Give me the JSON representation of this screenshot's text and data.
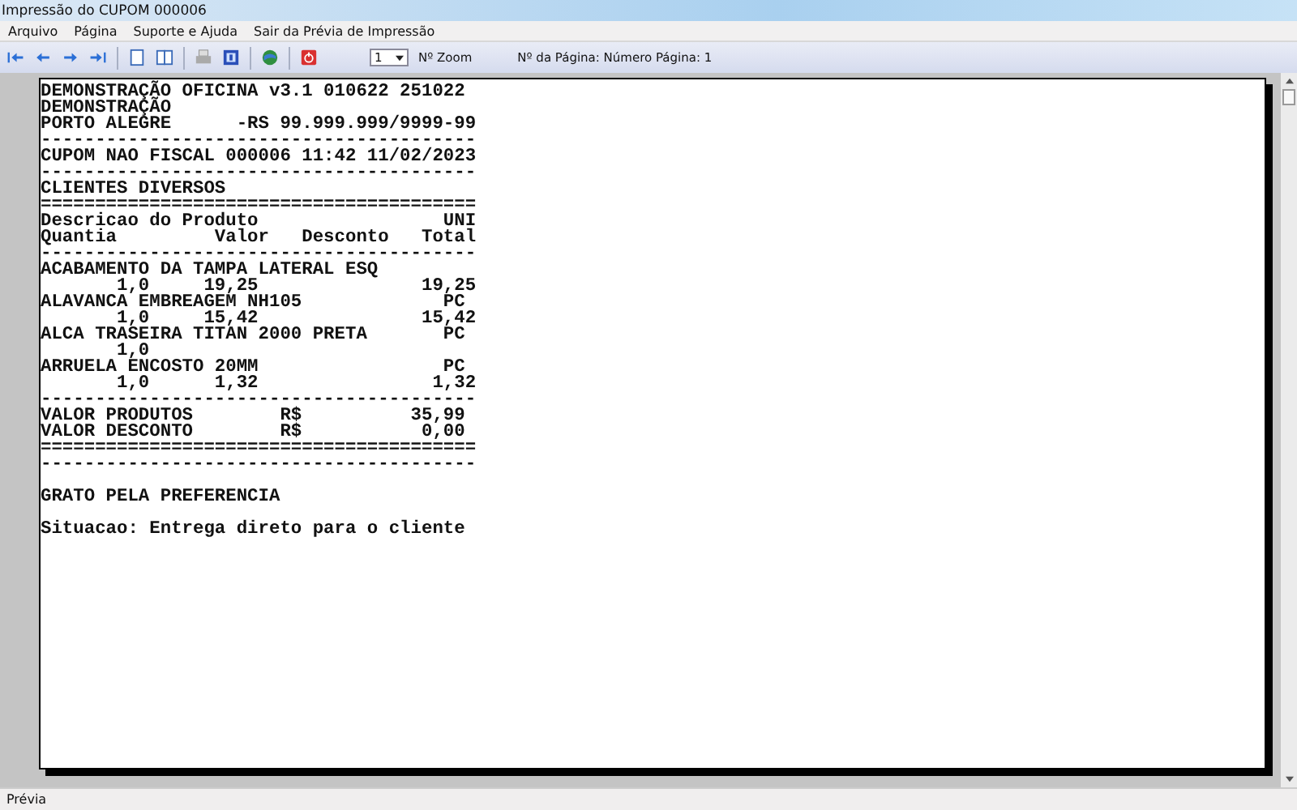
{
  "window": {
    "title": "Impressão do CUPOM 000006"
  },
  "menu": [
    "Arquivo",
    "Página",
    "Suporte e Ajuda",
    "Sair da Prévia de Impressão"
  ],
  "toolbar": {
    "zoom_value": "1",
    "zoom_label": "Nº Zoom",
    "page_label": "Nº da Página: Número Página: 1"
  },
  "receipt": {
    "lines": [
      {
        "text": "DEMONSTRAÇÃO OFICINA v3.1 010622 251022",
        "blank_before": false
      },
      {
        "text": "DEMONSTRAÇÃO",
        "blank_before": false
      },
      {
        "text": "PORTO ALEGRE      -RS 99.999.999/9999-99",
        "blank_before": false
      },
      {
        "text": "----------------------------------------",
        "blank_before": false
      },
      {
        "text": "CUPOM NAO FISCAL 000006 11:42 11/02/2023",
        "blank_before": false
      },
      {
        "text": "----------------------------------------",
        "blank_before": false
      },
      {
        "text": "CLIENTES DIVERSOS",
        "blank_before": false
      },
      {
        "text": "========================================",
        "blank_before": false
      },
      {
        "text": "Descricao do Produto                 UNI",
        "blank_before": false
      },
      {
        "text": "Quantia         Valor   Desconto   Total",
        "blank_before": false
      },
      {
        "text": "----------------------------------------",
        "blank_before": false
      },
      {
        "text": "ACABAMENTO DA TAMPA LATERAL ESQ",
        "blank_before": false
      },
      {
        "text": "       1,0     19,25               19,25",
        "blank_before": false
      },
      {
        "text": "ALAVANCA EMBREAGEM NH105             PC",
        "blank_before": false
      },
      {
        "text": "       1,0     15,42               15,42",
        "blank_before": false
      },
      {
        "text": "ALCA TRASEIRA TITAN 2000 PRETA       PC",
        "blank_before": false
      },
      {
        "text": "       1,0",
        "blank_before": false
      },
      {
        "text": "ARRUELA ENCOSTO 20MM                 PC",
        "blank_before": false
      },
      {
        "text": "       1,0      1,32                1,32",
        "blank_before": false
      },
      {
        "text": "----------------------------------------",
        "blank_before": false
      },
      {
        "text": "VALOR PRODUTOS        R$          35,99",
        "blank_before": false
      },
      {
        "text": "VALOR DESCONTO        R$           0,00",
        "blank_before": false
      },
      {
        "text": "========================================",
        "blank_before": false
      },
      {
        "text": "----------------------------------------",
        "blank_before": false
      },
      {
        "text": "GRATO PELA PREFERENCIA",
        "blank_before": true
      },
      {
        "text": "Situacao: Entrega direto para o cliente",
        "blank_before": true
      }
    ]
  },
  "status_bar": "Prévia"
}
